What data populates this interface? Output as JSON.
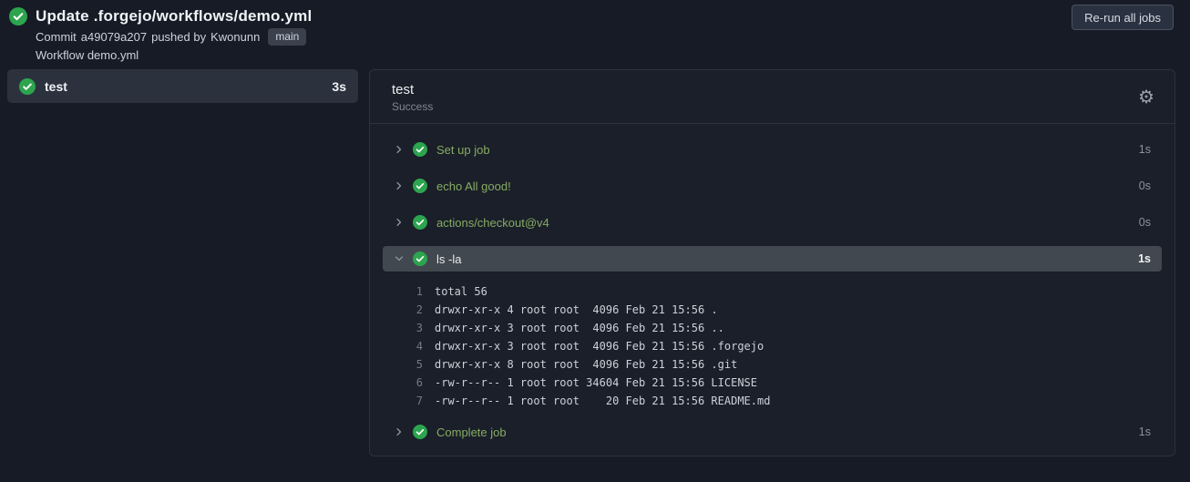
{
  "colors": {
    "success_green": "#2da44e",
    "step_label_green": "#87ab63",
    "page_background": "#161b26",
    "expanded_row_highlight": "#42484f"
  },
  "icons": {
    "gear": "⚙",
    "status": "success-check-icon",
    "chevron_collapsed": "chevron-right-icon",
    "chevron_expanded": "chevron-down-icon"
  },
  "header": {
    "title": "Update .forgejo/workflows/demo.yml",
    "commit": {
      "prefix": "Commit",
      "sha": "a49079a207",
      "middle": "pushed by",
      "author": "Kwonunn",
      "branch": "main"
    },
    "workflow_line": "Workflow demo.yml",
    "rerun_button_label": "Re-run all jobs"
  },
  "sidebar": {
    "jobs": [
      {
        "name": "test",
        "duration": "3s",
        "status": "success",
        "selected": true
      }
    ]
  },
  "main": {
    "job_title": "test",
    "job_status": "Success",
    "steps": [
      {
        "label": "Set up job",
        "duration": "1s",
        "expanded": false
      },
      {
        "label": "echo All good!",
        "duration": "0s",
        "expanded": false
      },
      {
        "label": "actions/checkout@v4",
        "duration": "0s",
        "expanded": false
      },
      {
        "label": "ls -la",
        "duration": "1s",
        "expanded": true,
        "logs": [
          {
            "num": "1",
            "text": "total 56"
          },
          {
            "num": "2",
            "text": "drwxr-xr-x 4 root root  4096 Feb 21 15:56 ."
          },
          {
            "num": "3",
            "text": "drwxr-xr-x 3 root root  4096 Feb 21 15:56 .."
          },
          {
            "num": "4",
            "text": "drwxr-xr-x 3 root root  4096 Feb 21 15:56 .forgejo"
          },
          {
            "num": "5",
            "text": "drwxr-xr-x 8 root root  4096 Feb 21 15:56 .git"
          },
          {
            "num": "6",
            "text": "-rw-r--r-- 1 root root 34604 Feb 21 15:56 LICENSE"
          },
          {
            "num": "7",
            "text": "-rw-r--r-- 1 root root    20 Feb 21 15:56 README.md"
          }
        ]
      },
      {
        "label": "Complete job",
        "duration": "1s",
        "expanded": false
      }
    ]
  }
}
